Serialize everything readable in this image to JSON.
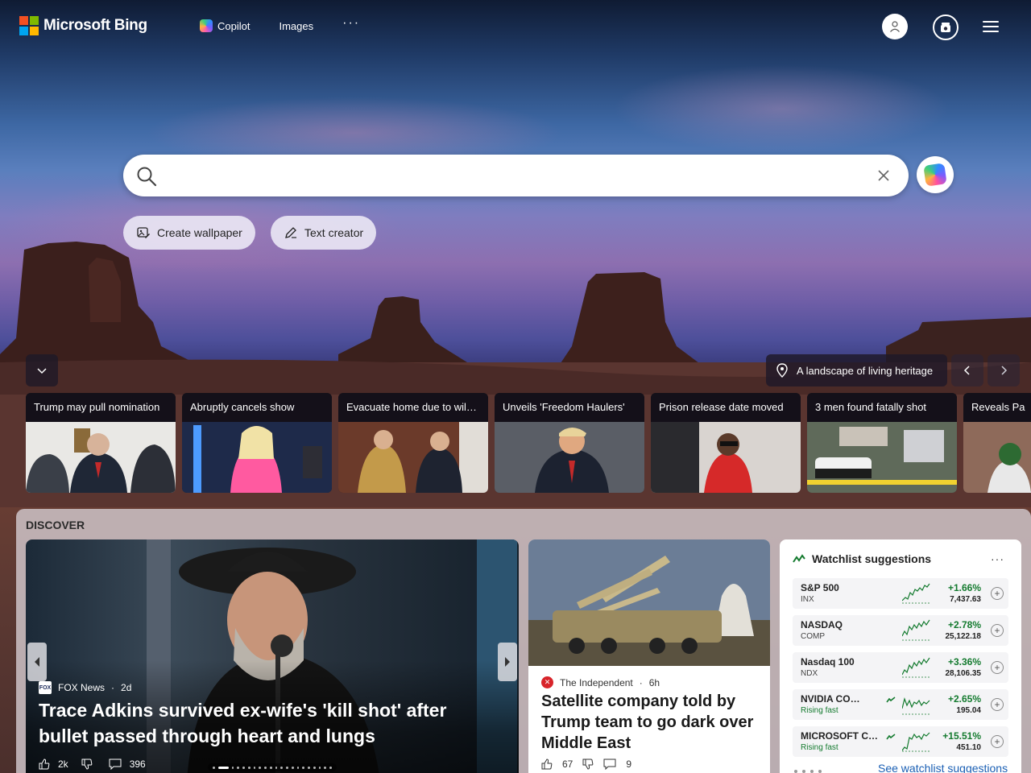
{
  "header": {
    "logo_text": "Microsoft Bing",
    "nav": [
      {
        "label": "Copilot",
        "icon": "copilot-icon"
      },
      {
        "label": "Images"
      },
      {
        "label": "···"
      }
    ],
    "icons": [
      "user-icon",
      "rewards-icon",
      "hamburger-menu-icon"
    ]
  },
  "search": {
    "placeholder": "",
    "value": ""
  },
  "chips": [
    {
      "label": "Create wallpaper",
      "icon": "image-edit-icon"
    },
    {
      "label": "Text creator",
      "icon": "pen-icon"
    }
  ],
  "image_caption": "A landscape of living heritage",
  "news_strip": [
    {
      "title": "Trump may pull nomination"
    },
    {
      "title": "Abruptly cancels show"
    },
    {
      "title": "Evacuate home due to wildfire"
    },
    {
      "title": "Unveils 'Freedom Haulers'"
    },
    {
      "title": "Prison release date moved"
    },
    {
      "title": "3 men found fatally shot"
    },
    {
      "title": "Reveals Pa"
    }
  ],
  "discover": {
    "title": "DISCOVER",
    "hero": {
      "source": "FOX News",
      "age": "2d",
      "headline": "Trace Adkins survived ex-wife's 'kill shot' after bullet passed through heart and lungs",
      "likes": "2k",
      "comments": "396"
    },
    "card2": {
      "source": "The Independent",
      "age": "6h",
      "headline": "Satellite company told by Trump team to go dark over Middle East",
      "likes": "67",
      "comments": "9"
    },
    "watchlist": {
      "title": "Watchlist suggestions",
      "more": "···",
      "rows": [
        {
          "name": "S&P 500",
          "sub": "INX",
          "pct": "+1.66%",
          "value": "7,437.63",
          "rising": false
        },
        {
          "name": "NASDAQ",
          "sub": "COMP",
          "pct": "+2.78%",
          "value": "25,122.18",
          "rising": false
        },
        {
          "name": "Nasdaq 100",
          "sub": "NDX",
          "pct": "+3.36%",
          "value": "28,106.35",
          "rising": false
        },
        {
          "name": "NVIDIA CORPORATION",
          "sub": "Rising fast",
          "pct": "+2.65%",
          "value": "195.04",
          "rising": true
        },
        {
          "name": "MICROSOFT CORPORATION",
          "sub": "Rising fast",
          "pct": "+15.51%",
          "value": "451.10",
          "rising": true
        }
      ],
      "link": "See watchlist suggestions"
    }
  },
  "colors": {
    "accent_green": "#137a2e",
    "link_blue": "#1a5fb4"
  }
}
